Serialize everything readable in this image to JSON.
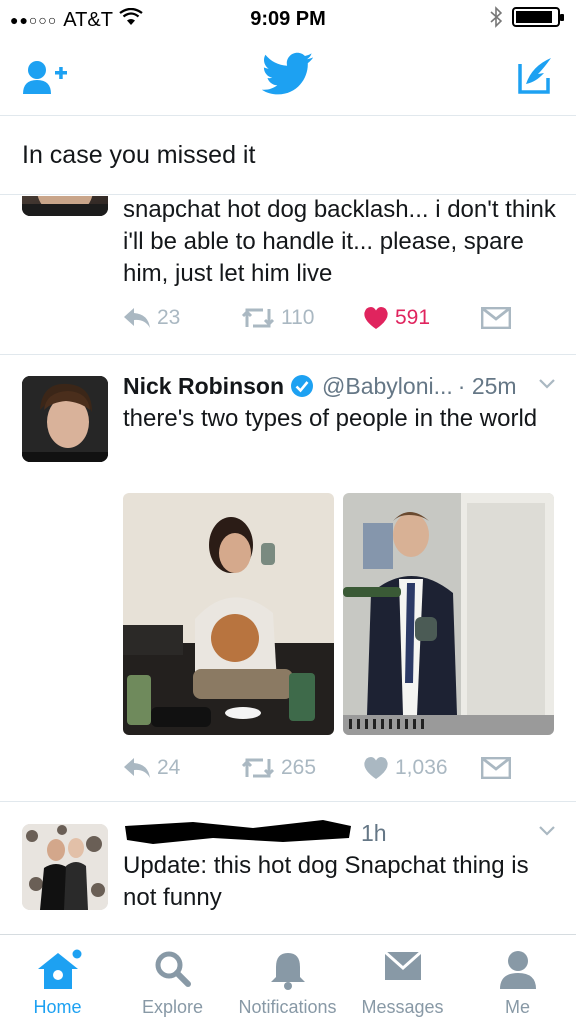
{
  "status_bar": {
    "carrier": "AT&T",
    "time": "9:09 PM",
    "signal_dots": "●●○○○"
  },
  "section_header": {
    "title": "In case you missed it"
  },
  "tweets": [
    {
      "text": "snapchat hot dog backlash... i don't think i'll be able to handle it... please, spare him, just let him live",
      "replies": "23",
      "retweets": "110",
      "likes": "591",
      "liked": true
    },
    {
      "name": "Nick Robinson",
      "handle": "@Babyloni...",
      "time": "· 25m",
      "verified": true,
      "text": "there's two types of people in the world",
      "replies": "24",
      "retweets": "265",
      "likes": "1,036",
      "liked": false
    },
    {
      "time": "1h",
      "text": "Update: this hot dog Snapchat thing is not funny"
    }
  ],
  "tabs": [
    {
      "label": "Home",
      "icon": "home-icon"
    },
    {
      "label": "Explore",
      "icon": "search-icon"
    },
    {
      "label": "Notifications",
      "icon": "bell-icon"
    },
    {
      "label": "Messages",
      "icon": "envelope-icon"
    },
    {
      "label": "Me",
      "icon": "person-icon"
    }
  ],
  "colors": {
    "accent": "#1da1f2",
    "like": "#e0245e",
    "muted": "#aab8c2",
    "text": "#14171a"
  }
}
